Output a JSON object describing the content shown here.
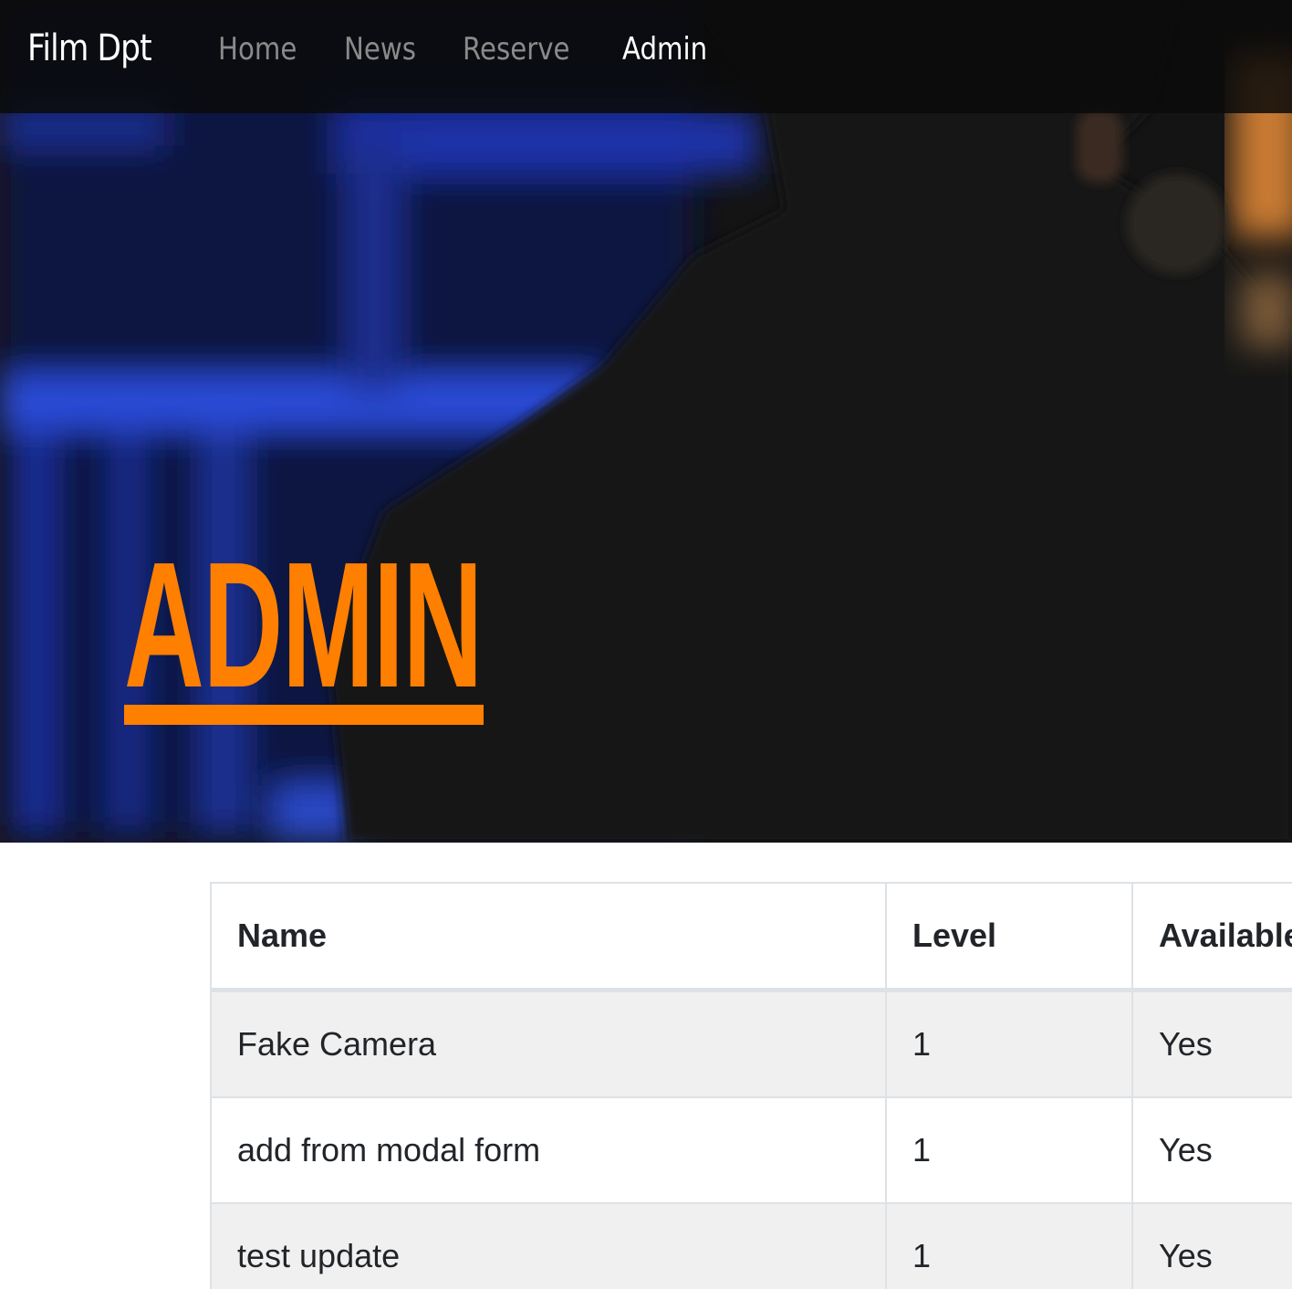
{
  "navbar": {
    "brand": "Film Dpt",
    "links": [
      {
        "label": "Home",
        "active": false
      },
      {
        "label": "News",
        "active": false
      },
      {
        "label": "Reserve",
        "active": false
      },
      {
        "label": "Admin",
        "active": true
      }
    ]
  },
  "hero": {
    "title": "ADMIN",
    "accent_color": "#ff7f00"
  },
  "table": {
    "headers": [
      "Name",
      "Level",
      "Available"
    ],
    "rows": [
      [
        "Fake Camera",
        "1",
        "Yes"
      ],
      [
        "add from modal form",
        "1",
        "Yes"
      ],
      [
        "test update",
        "1",
        "Yes"
      ]
    ]
  }
}
